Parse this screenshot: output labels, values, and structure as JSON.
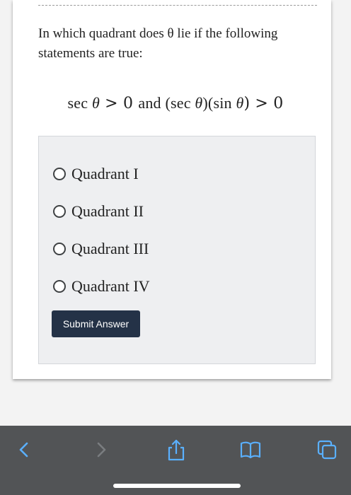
{
  "question": {
    "text": "In which quadrant does θ lie if the following statements are true:"
  },
  "formula": {
    "part1": "sec ",
    "theta1": "θ",
    "part2": " > 0 ",
    "connector": "and",
    "part3": " (sec ",
    "theta2": "θ",
    "part4": ")(sin ",
    "theta3": "θ",
    "part5": ") > 0"
  },
  "options": [
    {
      "label": "Quadrant I"
    },
    {
      "label": "Quadrant II"
    },
    {
      "label": "Quadrant III"
    },
    {
      "label": "Quadrant IV"
    }
  ],
  "submit_label": "Submit Answer",
  "toolbar": {
    "icons": [
      "back-chevron-icon",
      "forward-chevron-icon",
      "share-icon",
      "bookmarks-icon",
      "tabs-icon"
    ],
    "icon_color": "#5ab0ff",
    "disabled_color": "#7a7d80"
  },
  "colors": {
    "submit_bg": "#243247",
    "toolbar_bg": "#525456"
  }
}
